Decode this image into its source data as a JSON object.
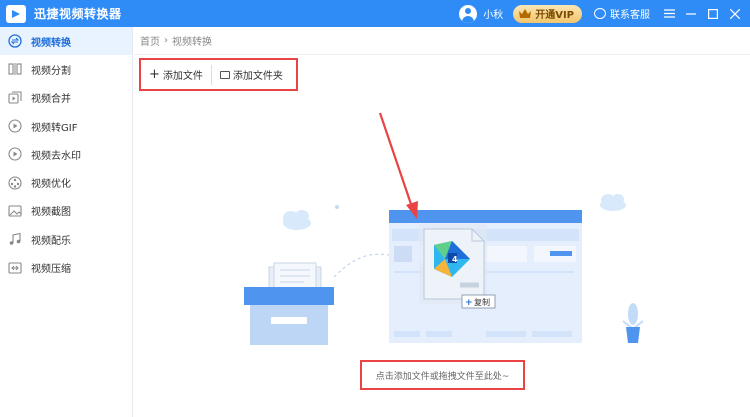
{
  "app": {
    "title": "迅捷视频转换器"
  },
  "titlebar": {
    "username": "小秋",
    "vip_label": "开通VIP",
    "service_label": "联系客服",
    "icons": [
      "menu-icon",
      "minimize-icon",
      "maximize-icon",
      "close-icon"
    ]
  },
  "sidebar": {
    "items": [
      {
        "label": "视频转换",
        "icon": "convert-icon",
        "active": true
      },
      {
        "label": "视频分割",
        "icon": "split-icon"
      },
      {
        "label": "视频合并",
        "icon": "merge-icon"
      },
      {
        "label": "视频转GIF",
        "icon": "gif-icon"
      },
      {
        "label": "视频去水印",
        "icon": "watermark-icon"
      },
      {
        "label": "视频优化",
        "icon": "optimize-icon"
      },
      {
        "label": "视频截图",
        "icon": "screenshot-icon"
      },
      {
        "label": "视频配乐",
        "icon": "music-icon"
      },
      {
        "label": "视频压缩",
        "icon": "compress-icon"
      }
    ]
  },
  "breadcrumb": {
    "home": "首页",
    "current": "视频转换"
  },
  "toolbar": {
    "add_file": "添加文件",
    "add_folder": "添加文件夹"
  },
  "illustration": {
    "file_badge": "4",
    "copy_label": "复制"
  },
  "hint": "点击添加文件或拖拽文件至此处~",
  "colors": {
    "titlebar": "#2f8cf6",
    "accent": "#1e6fd9",
    "highlight_box": "#e94343"
  }
}
